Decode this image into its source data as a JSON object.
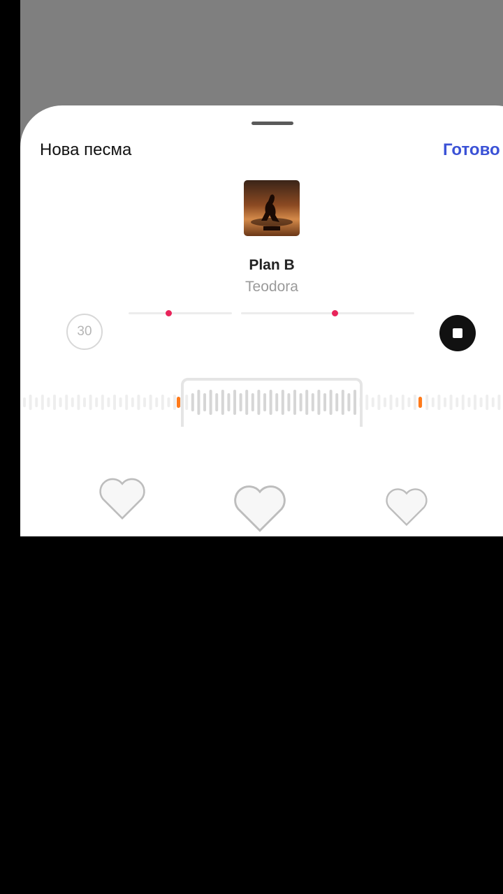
{
  "header": {
    "title": "Нова песма",
    "done_label": "Готово"
  },
  "song": {
    "title": "Plan B",
    "artist": "Teodora",
    "cover_icon": "album-cover"
  },
  "player": {
    "duration": "30",
    "stop_icon": "stop-icon"
  },
  "colors": {
    "accent": "#3b52d6",
    "marker": "#e8245a",
    "sheet": "#ffffff",
    "backdrop": "#7f7f7f"
  },
  "reactions": [
    "white-heart-icon",
    "white-heart-icon",
    "white-heart-icon"
  ]
}
